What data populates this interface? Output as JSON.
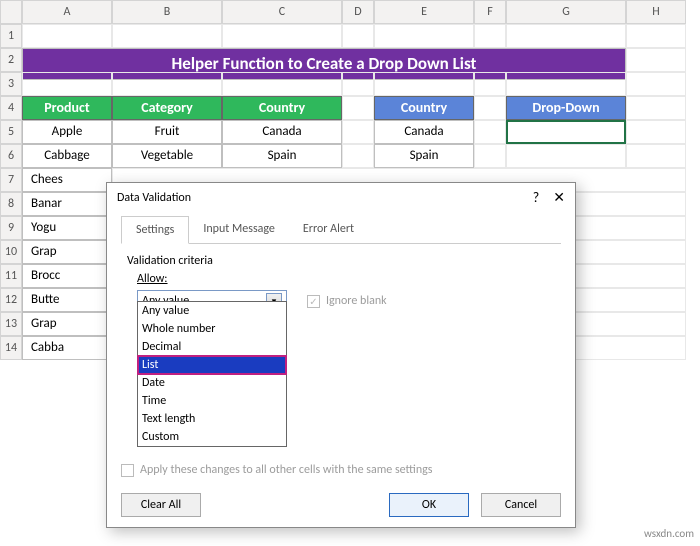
{
  "columns": [
    "A",
    "B",
    "C",
    "D",
    "E",
    "F",
    "G",
    "H"
  ],
  "rows": [
    "1",
    "2",
    "3",
    "4",
    "5",
    "6",
    "7",
    "8",
    "9",
    "10",
    "11",
    "12",
    "13",
    "14"
  ],
  "title": "Helper Function to Create a Drop Down List",
  "headers": {
    "product": "Product",
    "category": "Category",
    "country_b": "Country",
    "country_f": "Country",
    "dropdown": "Drop-Down"
  },
  "table_b": [
    "Apple",
    "Cabbage",
    "Chees",
    "Banar",
    "Yogu",
    "Grap",
    "Brocc",
    "Butte",
    "Grap",
    "Cabba"
  ],
  "table_c": [
    "Fruit",
    "Vegetable"
  ],
  "table_d": [
    "Canada",
    "Spain"
  ],
  "table_f": [
    "Canada",
    "Spain"
  ],
  "dialog": {
    "title": "Data Validation",
    "help": "?",
    "close": "✕",
    "tabs": {
      "settings": "Settings",
      "input": "Input Message",
      "error": "Error Alert"
    },
    "criteria_label": "Validation criteria",
    "allow_label": "Allow:",
    "allow_value": "Any value",
    "allow_options": [
      "Any value",
      "Whole number",
      "Decimal",
      "List",
      "Date",
      "Time",
      "Text length",
      "Custom"
    ],
    "ignore_blank": "Ignore blank",
    "apply_label": "Apply these changes to all other cells with the same settings",
    "clear": "Clear All",
    "ok": "OK",
    "cancel": "Cancel"
  },
  "watermark": "wsxdn.com"
}
